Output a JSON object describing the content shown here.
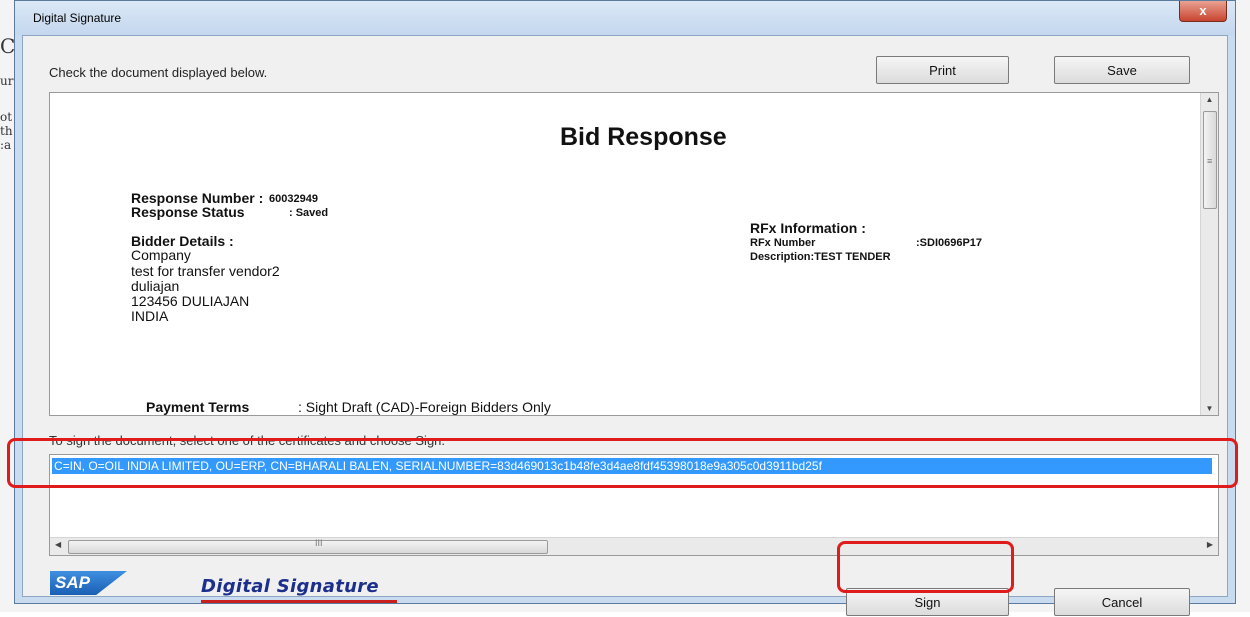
{
  "background_fragments": [
    "C",
    "ur",
    "ot",
    "th",
    ":a"
  ],
  "dialog": {
    "title": "Digital Signature",
    "close_glyph": "x",
    "instruction": "Check the document displayed below.",
    "print_label": "Print",
    "save_label": "Save",
    "sign_label": "Sign",
    "cancel_label": "Cancel",
    "cert_prompt": "To sign the document, select one of the certificates and choose Sign.",
    "certificates": [
      "C=IN, O=OIL INDIA LIMITED, OU=ERP, CN=BHARALI BALEN, SERIALNUMBER=83d469013c1b48fe3d4ae8fdf45398018e9a305c0d3911bd25f"
    ],
    "scroll_grip": "≡",
    "hscroll_grip": "III"
  },
  "document": {
    "title": "Bid  Response",
    "response_number_label": "Response Number :",
    "response_number": "60032949",
    "response_status_label": "Response Status",
    "response_status": ": Saved",
    "bidder_details_label": "Bidder Details :",
    "bidder_lines": [
      "Company",
      "test for transfer vendor2",
      "duliajan",
      "123456 DULIAJAN",
      "INDIA"
    ],
    "rfx_info_label": "RFx Information :",
    "rfx_number_label": "RFx Number",
    "rfx_number": ":SDI0696P17",
    "description": "Description:TEST TENDER",
    "payment_terms_label": "Payment Terms",
    "payment_terms": ":  Sight Draft (CAD)-Foreign Bidders Only"
  },
  "branding": {
    "sap_logo": "SAP",
    "digital_signature_logo": "Digital Signature"
  },
  "colors": {
    "highlight": "#e01b1b",
    "selection": "#3399ff",
    "titlebar": "#c4d7ee"
  }
}
